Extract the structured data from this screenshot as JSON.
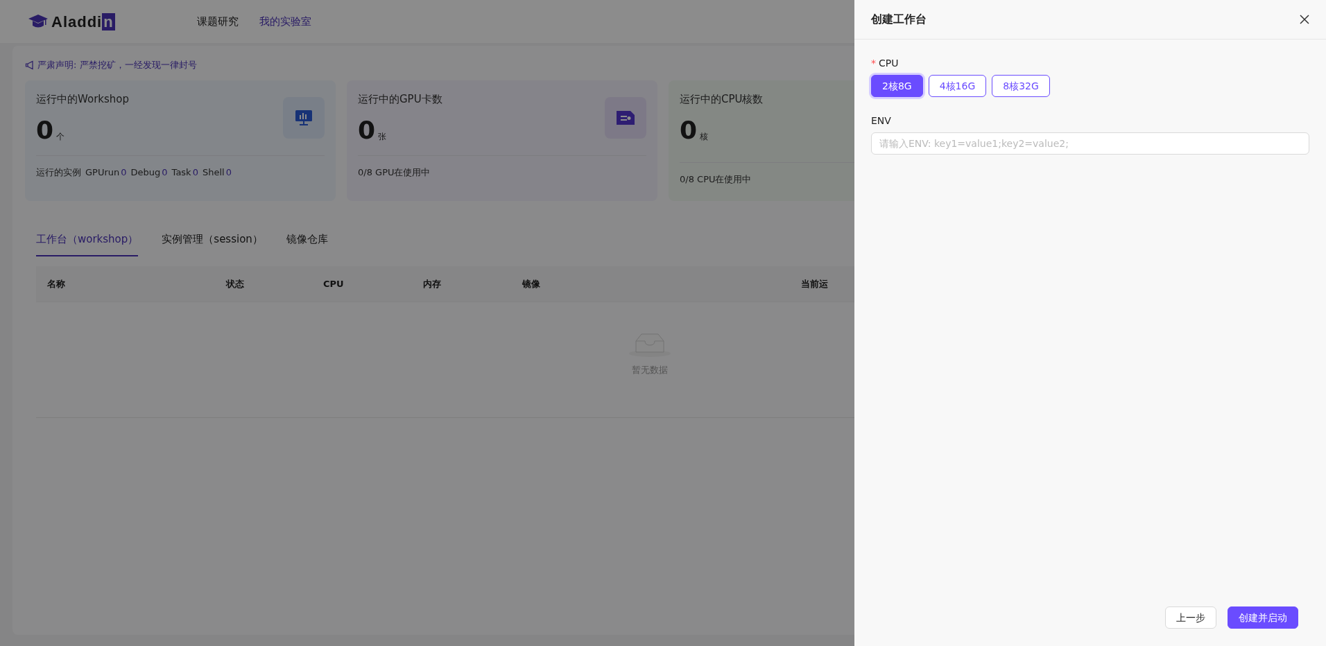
{
  "header": {
    "logo": "Aladdin",
    "nav": [
      {
        "label": "课题研究",
        "selected": false
      },
      {
        "label": "我的实验室",
        "selected": true
      }
    ]
  },
  "notice": "严肃声明: 严禁挖矿，一经发现一律封号",
  "stats": [
    {
      "kind": "workshop",
      "title": "运行中的Workshop",
      "value": "0",
      "unit": "个",
      "footer_label": "运行的实例",
      "counts": [
        {
          "label": "GPUrun",
          "count": "0"
        },
        {
          "label": "Debug",
          "count": "0"
        },
        {
          "label": "Task",
          "count": "0"
        },
        {
          "label": "Shell",
          "count": "0"
        }
      ]
    },
    {
      "kind": "gpu",
      "title": "运行中的GPU卡数",
      "value": "0",
      "unit": "张",
      "footer_label": "0/8 GPU在使用中"
    },
    {
      "kind": "cpu",
      "title": "运行中的CPU核数",
      "value": "0",
      "unit": "核",
      "footer_label": "0/8 CPU在使用中"
    }
  ],
  "tabs": [
    {
      "label": "工作台（workshop）",
      "selected": true
    },
    {
      "label": "实例管理（session）",
      "selected": false
    },
    {
      "label": "镜像仓库",
      "selected": false
    }
  ],
  "table": {
    "columns": [
      "名称",
      "状态",
      "CPU",
      "内存",
      "镜像",
      "当前运"
    ],
    "empty_text": "暂无数据"
  },
  "drawer": {
    "title": "创建工作台",
    "fields": [
      {
        "kind": "options",
        "label": "CPU",
        "required_mark": "*",
        "options": [
          {
            "label": "2核8G",
            "selected": true
          },
          {
            "label": "4核16G",
            "selected": false
          },
          {
            "label": "8核32G",
            "selected": false
          }
        ]
      },
      {
        "kind": "text",
        "label": "ENV",
        "placeholder": "请输入ENV: key1=value1;key2=value2;"
      }
    ],
    "buttons": [
      {
        "label": "上一步",
        "primary": false
      },
      {
        "label": "创建并启动",
        "primary": true
      }
    ]
  }
}
